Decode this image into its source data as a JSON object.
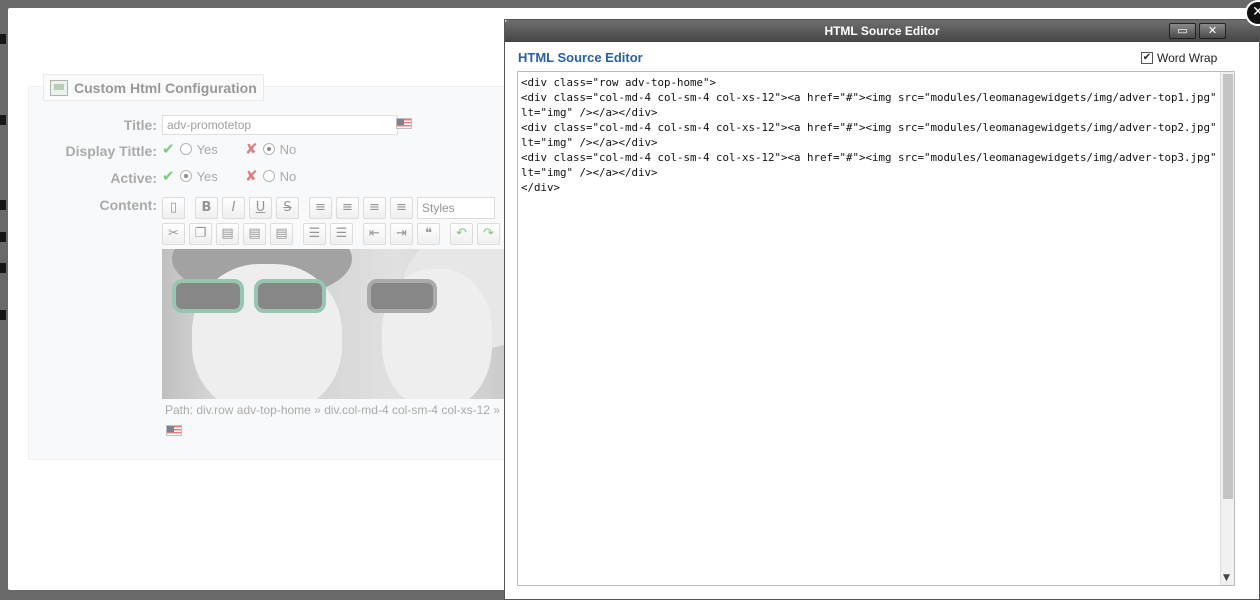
{
  "config_panel": {
    "legend": "Custom Html Configuration",
    "title_label": "Title:",
    "title_value": "adv-promotetop",
    "display_title_label": "Display Tittle:",
    "active_label": "Active:",
    "content_label": "Content:",
    "yes": "Yes",
    "no": "No",
    "styles_placeholder": "Styles",
    "path_text": "Path: div.row adv-top-home » div.col-md-4 col-sm-4 col-xs-12 »"
  },
  "source_editor": {
    "window_title": "HTML Source Editor",
    "heading": "HTML Source Editor",
    "word_wrap_label": "Word Wrap",
    "word_wrap_checked": true,
    "code": "<div class=\"row adv-top-home\">\n<div class=\"col-md-4 col-sm-4 col-xs-12\"><a href=\"#\"><img src=\"modules/leomanagewidgets/img/adver-top1.jpg\" alt=\"img\" /></a></div>\n<div class=\"col-md-4 col-sm-4 col-xs-12\"><a href=\"#\"><img src=\"modules/leomanagewidgets/img/adver-top2.jpg\" alt=\"img\" /></a></div>\n<div class=\"col-md-4 col-sm-4 col-xs-12\"><a href=\"#\"><img src=\"modules/leomanagewidgets/img/adver-top3.jpg\" alt=\"img\" /></a></div>\n</div>"
  },
  "colors": {
    "heading_blue": "#2b5fa0",
    "titlebar": "#555555",
    "check_green": "#33aa33",
    "x_red": "#cc3333"
  }
}
